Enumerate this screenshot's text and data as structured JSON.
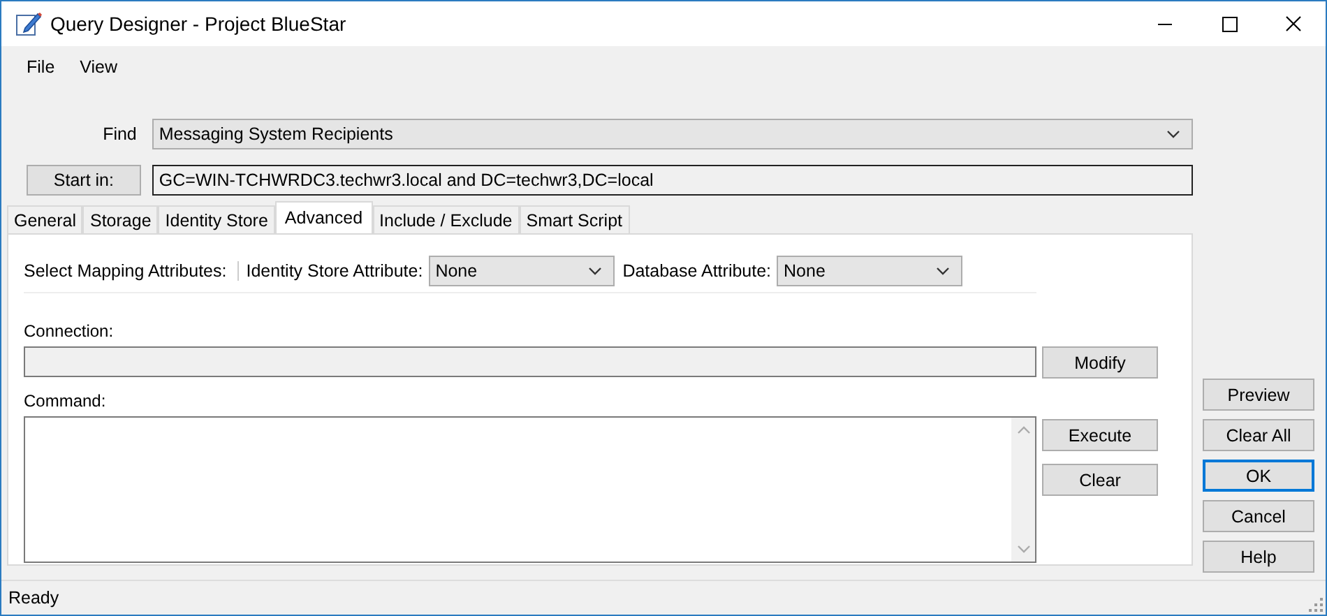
{
  "window": {
    "title": "Query Designer - Project BlueStar"
  },
  "menu": [
    {
      "label": "File"
    },
    {
      "label": "View"
    }
  ],
  "find": {
    "label": "Find",
    "value": "Messaging System Recipients"
  },
  "start_in": {
    "button": "Start in:",
    "value": "GC=WIN-TCHWRDC3.techwr3.local and DC=techwr3,DC=local"
  },
  "tabs": [
    {
      "label": "General",
      "selected": false
    },
    {
      "label": "Storage",
      "selected": false
    },
    {
      "label": "Identity Store",
      "selected": false
    },
    {
      "label": "Advanced",
      "selected": true
    },
    {
      "label": "Include / Exclude",
      "selected": false
    },
    {
      "label": "Smart Script",
      "selected": false
    }
  ],
  "mapping": {
    "label": "Select Mapping Attributes:",
    "fields": [
      {
        "label": "Identity Store Attribute:",
        "value": "None"
      },
      {
        "label": "Database Attribute:",
        "value": "None"
      }
    ]
  },
  "connection": {
    "label": "Connection:",
    "button": "Modify"
  },
  "command": {
    "label": "Command:",
    "buttons": [
      "Execute",
      "Clear"
    ]
  },
  "side_buttons": [
    {
      "label": "Preview",
      "default": false
    },
    {
      "label": "Clear All",
      "default": false
    },
    {
      "label": "OK",
      "default": true
    },
    {
      "label": "Cancel",
      "default": false
    },
    {
      "label": "Help",
      "default": false
    }
  ],
  "status_bar": {
    "text": "Ready"
  }
}
